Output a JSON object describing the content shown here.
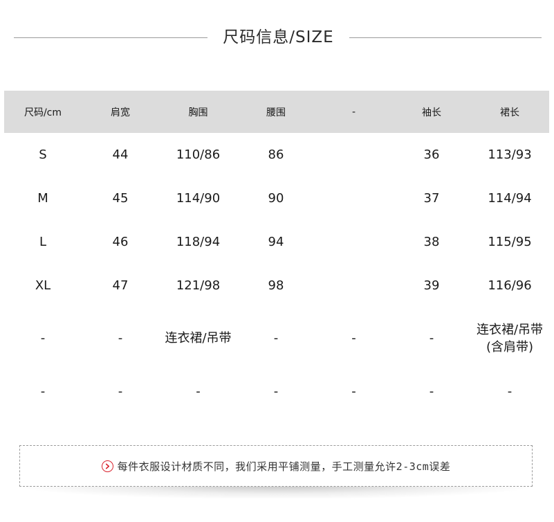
{
  "title": "尺码信息/SIZE",
  "table": {
    "headers": [
      "尺码/cm",
      "肩宽",
      "胸围",
      "腰围",
      "-",
      "袖长",
      "裙长"
    ],
    "rows": [
      [
        "S",
        "44",
        "110/86",
        "86",
        "",
        "36",
        "113/93"
      ],
      [
        "M",
        "45",
        "114/90",
        "90",
        "",
        "37",
        "114/94"
      ],
      [
        "L",
        "46",
        "118/94",
        "94",
        "",
        "38",
        "115/95"
      ],
      [
        "XL",
        "47",
        "121/98",
        "98",
        "",
        "39",
        "116/96"
      ],
      [
        "-",
        "-",
        "连衣裙/吊带",
        "-",
        "-",
        "-",
        "连衣裙/吊带"
      ],
      [
        "-",
        "-",
        "-",
        "-",
        "-",
        "-",
        "-"
      ]
    ],
    "row5_col7_second_line": "(含肩带)"
  },
  "note": {
    "icon": "chevron-right-circle-icon",
    "text": "每件衣服设计材质不同，我们采用平铺测量，手工测量允许2-3cm误差",
    "icon_color": "#d9232e"
  }
}
